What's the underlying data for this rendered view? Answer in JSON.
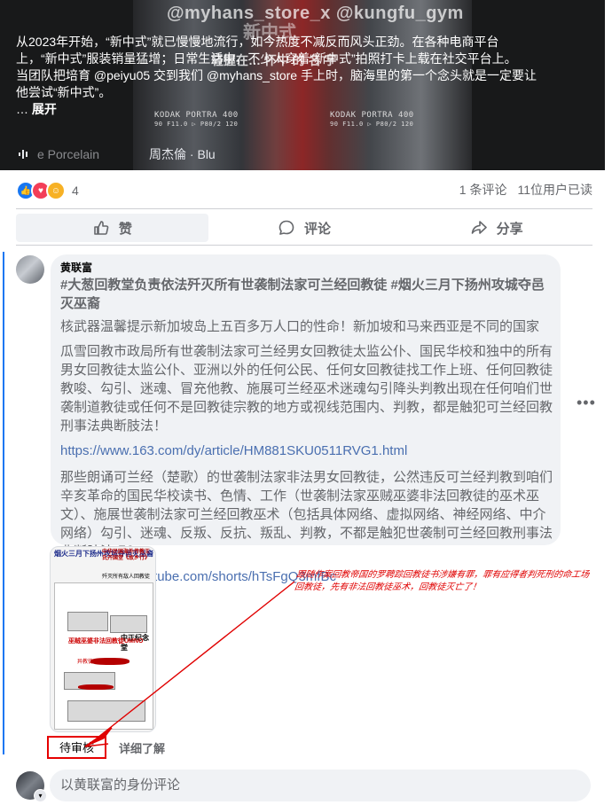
{
  "video": {
    "watermark": "@myhans_store_x @kungfu_gym",
    "overlay_title": "新中式",
    "film_label": "KODAK PORTRA 400",
    "film_sub": "90 F11.0 ▷ P80/2 120",
    "lyric_line": "轻握在… 怀中 的 名 字",
    "caption_lines": [
      "从2023年开始，“新中式”就已慢慢地流行，如今热度不减反而风头正劲。在各种电商平台上，“新中式”服装销量猛增；日常生活中，不少人穿着“新中式”拍照打卡上载在社交平台上。",
      "当团队把培育 @peiyu05 交到我们 @myhans_store 手上时，脑海里的第一个念头就是一定要让他尝试“新中式”。"
    ],
    "ellipsis": "…",
    "see_more": "展开",
    "music_song": "e Porcelain",
    "music_artist": "周杰倫 · Blu"
  },
  "summary": {
    "reaction_count": "4",
    "comments": "1 条评论",
    "views": "11位用户已读"
  },
  "actions": {
    "like": "赞",
    "comment": "评论",
    "share": "分享"
  },
  "comment": {
    "author": "黄联富",
    "hashtags": "#大葱回教堂负责依法歼灭所有世袭制法家可兰经回教徒 #烟火三月下扬州攻城夺邑灭巫裔",
    "line1": "核武器温馨提示新加坡岛上五百多万人口的性命！新加坡和马来西亚是不同的国家",
    "para1": "瓜雪回教市政局所有世袭制法家可兰经男女回教徒太监公仆、国民华校和独中的所有男女回教徒太监公仆、亚洲以外的任何公民、任何女回教徒找工作上班、任何回教徒教唆、勾引、迷魂、冒充他教、施展可兰经巫术迷魂勾引降头判教出现在任何咱们世袭制道教徒或任何不是回教徒宗教的地方或视线范围内、判教，都是触犯可兰经回教刑事法典断肢法！",
    "link1": "https://www.163.com/dy/article/HM881SKU0511RVG1.html",
    "para2": "那些朗诵可兰经（楚歌）的世袭制法家非法男女回教徒，公然违反可兰经判教到咱们辛亥革命的国民华校读书、色情、工作（世袭制法家巫贼巫婆非法回教徒的巫术巫文）、施展世袭制法家可兰经回教巫术（包括具体网络、虚拟网络、神经网络、中介网络）勾引、迷魂、反叛、反抗、叛乱、判教，不都是触犯世袭制可兰经回教刑事法典断肢法吗？",
    "link2": "https://www.youtube.com/shorts/hTsFgQ3mfBc",
    "more_label": "•••"
  },
  "attachment": {
    "header_blue": "烟火三月下扬州攻城夺邑灭巫裔",
    "header_red": "中华民国海外传教王氏开国堂《故乡行》",
    "sub": "歼灭所有敌人回教徒",
    "memorial": "中正纪念堂",
    "banner": "巫贼巫婆非法回教徒UMNO",
    "banner_sub": "异教徒"
  },
  "meta": {
    "pending": "待审核",
    "learn_more": "详细了解"
  },
  "annotation": {
    "text": "跟随作案回教帝国的罗聘踪回教徒书涉嫌有罪，罪有应得者判死刑的命工场回教徒，先有非法回教徒巫术，回教徒灭亡了！"
  },
  "composer": {
    "placeholder": "以黄联富的身份评论"
  }
}
